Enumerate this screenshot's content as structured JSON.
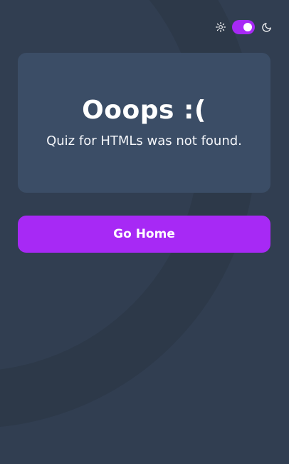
{
  "theme": {
    "light_icon": "sun-icon",
    "dark_icon": "moon-icon",
    "mode": "dark",
    "toggle_color": "#a729f5"
  },
  "card": {
    "title": "Ooops :(",
    "message": "Quiz for HTMLs was not found."
  },
  "actions": {
    "home_label": "Go Home"
  },
  "colors": {
    "background": "#313e51",
    "card": "#3b4d66",
    "accent": "#a729f5",
    "text": "#ffffff"
  }
}
